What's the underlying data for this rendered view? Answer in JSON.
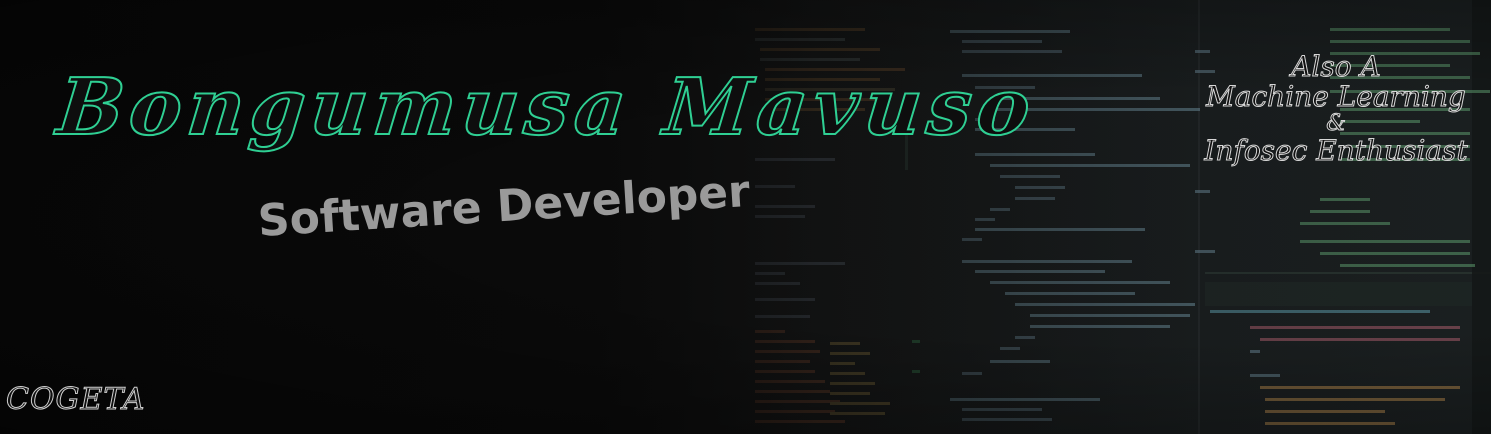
{
  "name": "Bongumusa  Mavuso",
  "role": "Software Developer",
  "also": {
    "line1": "Also A",
    "line2": "Machine Learning",
    "line3": "&",
    "line4": "Infosec Enthusiast"
  },
  "logo_text": "COGETA",
  "colors": {
    "name_green": "#2fcf93",
    "role_gray": "#9a9a9a",
    "background": "#0c0c0c"
  }
}
